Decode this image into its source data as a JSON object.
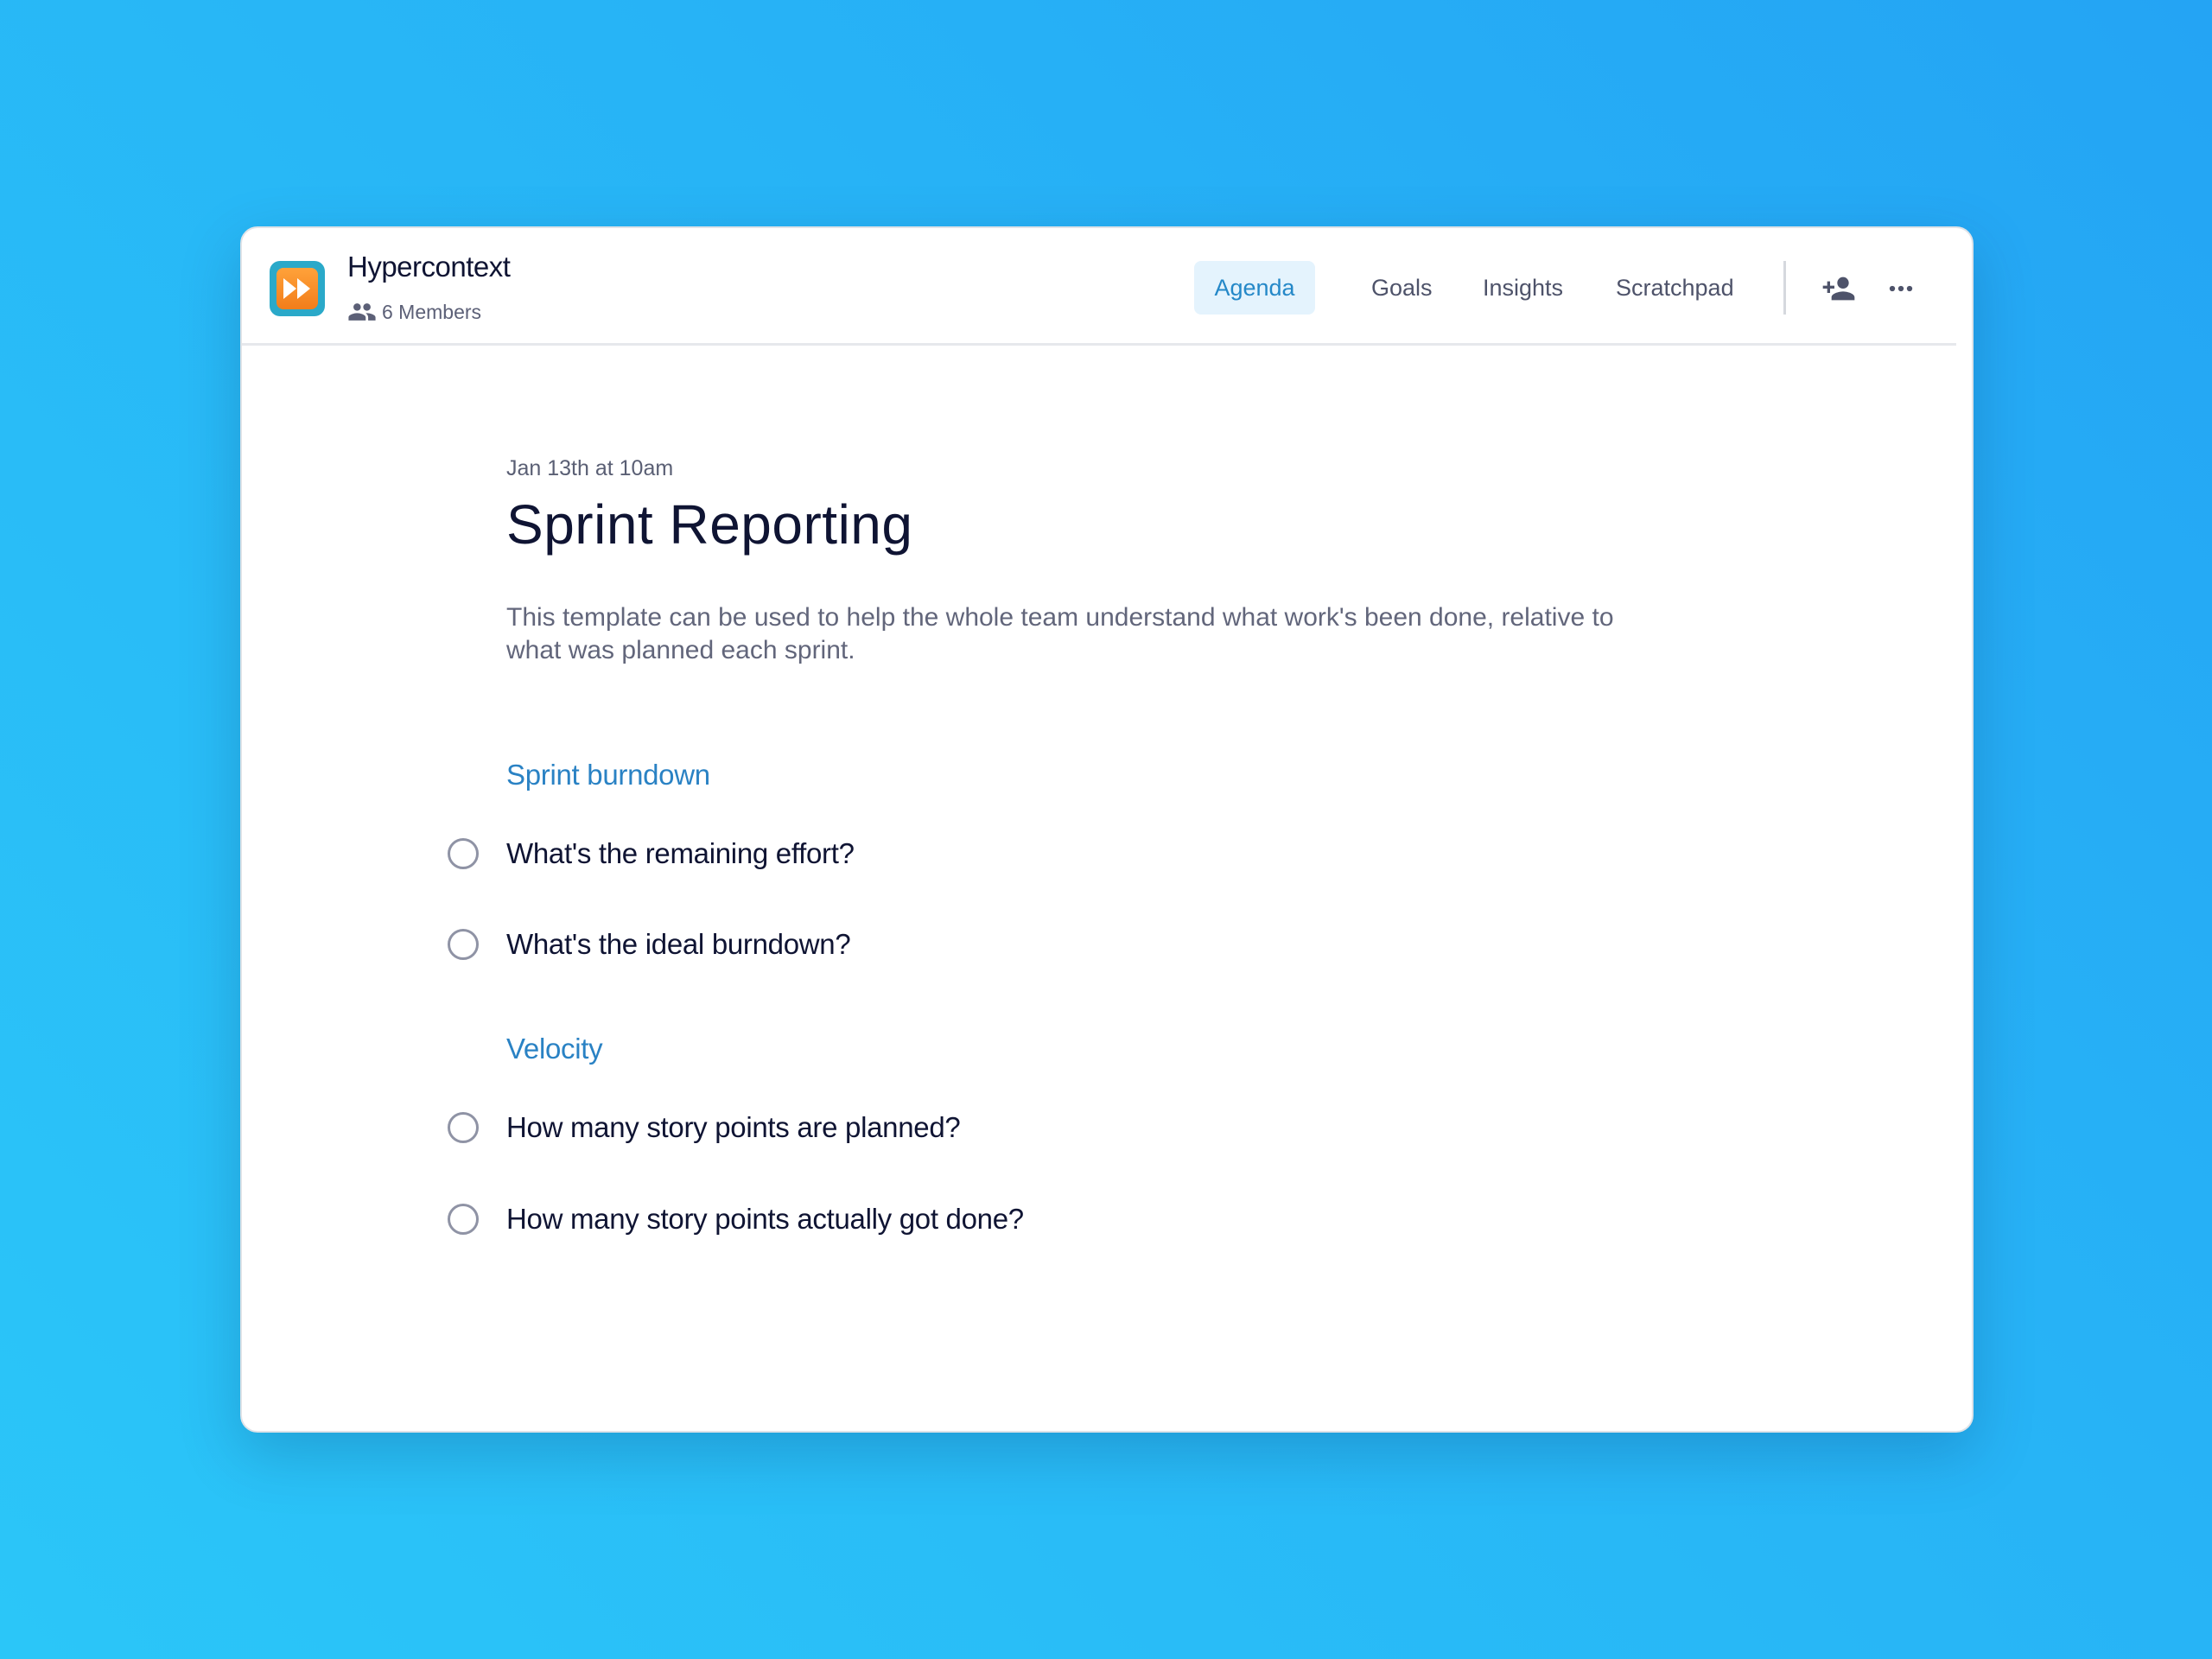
{
  "header": {
    "title": "Hypercontext",
    "members_label": "6 Members",
    "tabs": [
      {
        "label": "Agenda",
        "active": true
      },
      {
        "label": "Goals",
        "active": false
      },
      {
        "label": "Insights",
        "active": false
      },
      {
        "label": "Scratchpad",
        "active": false
      }
    ]
  },
  "meeting": {
    "date": "Jan 13th at 10am",
    "title": "Sprint Reporting",
    "description": "This template can be used to help the whole team understand what work's been done, relative to what was planned each sprint."
  },
  "sections": [
    {
      "heading": "Sprint burndown",
      "items": [
        {
          "label": "What's the remaining effort?",
          "checked": false
        },
        {
          "label": "What's the ideal burndown?",
          "checked": false
        }
      ]
    },
    {
      "heading": "Velocity",
      "items": [
        {
          "label": "How many story points are planned?",
          "checked": false
        },
        {
          "label": "How many story points actually got done?",
          "checked": false
        }
      ]
    }
  ],
  "icons": {
    "app_logo": "fast-forward-icon",
    "members": "people-icon",
    "add_member": "person-add-icon",
    "more": "more-horizontal-icon"
  },
  "colors": {
    "accent": "#2488c8",
    "active_tab_bg": "#e4f3fd",
    "section_heading": "#2a82c4",
    "logo_orange": "#f58c24",
    "logo_teal": "#2aa9c9"
  }
}
